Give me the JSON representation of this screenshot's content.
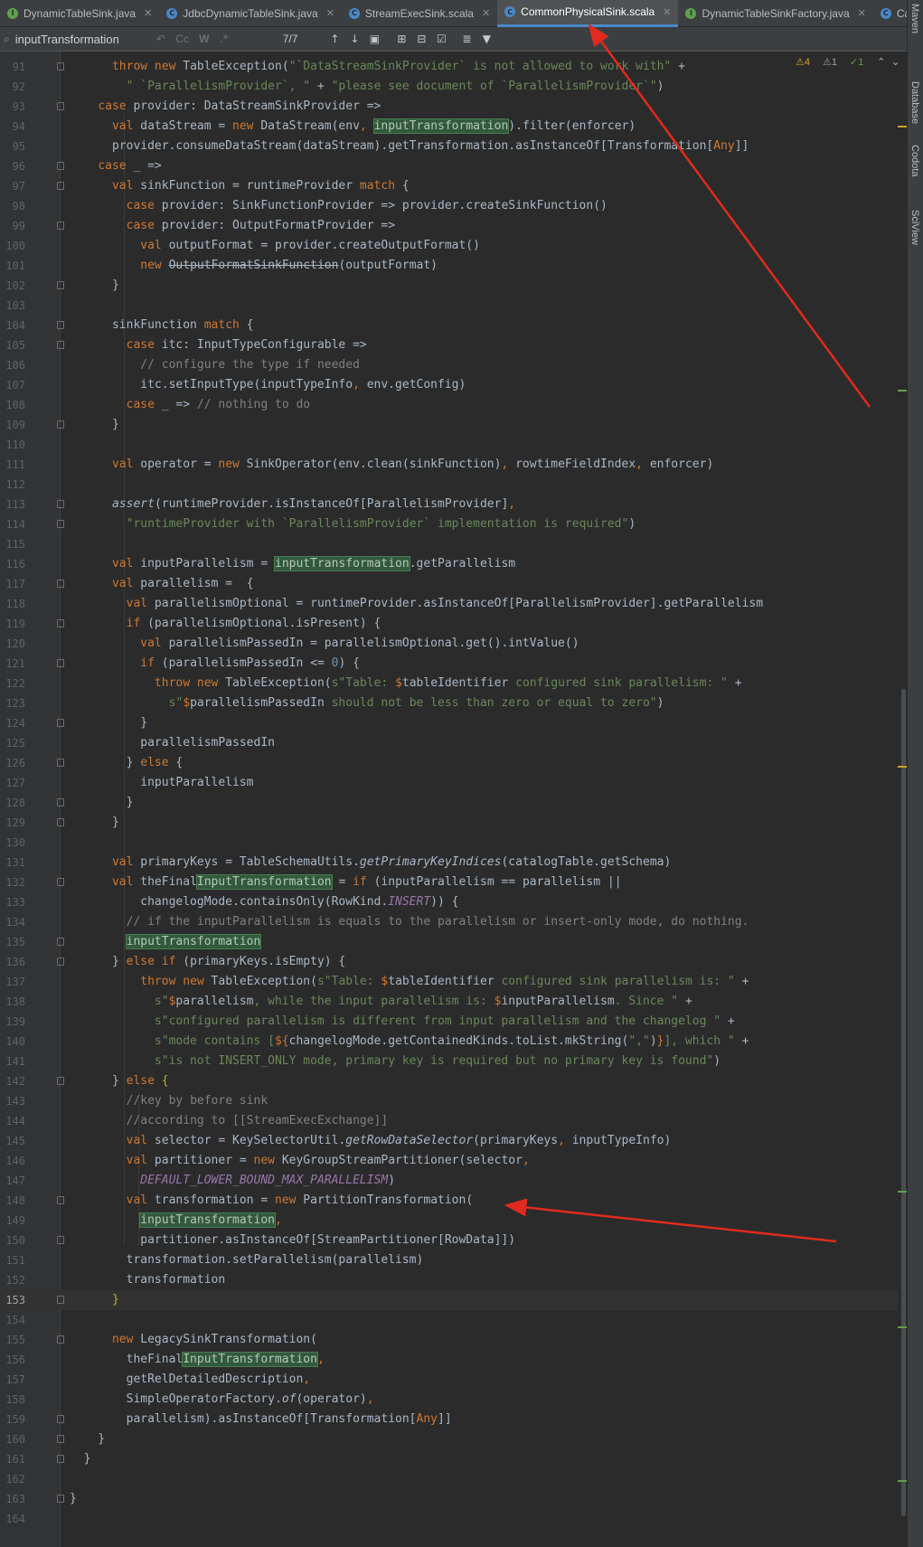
{
  "tabs": [
    {
      "label": "DynamicTableSink.java",
      "icon": "interface-icon",
      "color": "#5fa04e",
      "letter": "I",
      "active": false
    },
    {
      "label": "JdbcDynamicTableSink.java",
      "icon": "class-icon",
      "color": "#4a88c7",
      "letter": "C",
      "active": false
    },
    {
      "label": "StreamExecSink.scala",
      "icon": "scala-class-icon",
      "color": "#4a88c7",
      "letter": "C",
      "active": false
    },
    {
      "label": "CommonPhysicalSink.scala",
      "icon": "scala-class-icon",
      "color": "#4a88c7",
      "letter": "C",
      "active": true
    },
    {
      "label": "DynamicTableSinkFactory.java",
      "icon": "interface-icon",
      "color": "#5fa04e",
      "letter": "I",
      "active": false
    },
    {
      "label": "Ca",
      "icon": "class-icon",
      "color": "#4a88c7",
      "letter": "C",
      "active": false
    }
  ],
  "find": {
    "query": "inputTransformation",
    "count": "7/7",
    "opt_case": "Cc",
    "opt_word": "W",
    "opt_regex": ".*"
  },
  "inspections": {
    "warnings": "4",
    "weak": "1",
    "ok": "1"
  },
  "right_tools": [
    "Maven",
    "Database",
    "Codota",
    "SciView"
  ],
  "current_line": 153,
  "lines": [
    {
      "n": 91,
      "html": "      <span class='k'>throw new</span> TableException(<span class='s'>\"`DataStreamSinkProvider` is not allowed to work with\"</span> +"
    },
    {
      "n": 92,
      "html": "        <span class='s'>\" `ParallelismProvider`, \"</span> + <span class='s'>\"please see document of `ParallelismProvider`\"</span>)"
    },
    {
      "n": 93,
      "html": "    <span class='k'>case</span> provider: DataStreamSinkProvider =>"
    },
    {
      "n": 94,
      "html": "      <span class='k'>val</span> dataStream = <span class='k'>new</span> DataStream(env<span class='k'>,</span> <span class='hl'>inputTransformation</span>).filter(enforcer)"
    },
    {
      "n": 95,
      "html": "      provider.consumeDataStream(dataStream).getTransformation.asInstanceOf[Transformation[<span class='k'>Any</span>]]"
    },
    {
      "n": 96,
      "html": "    <span class='k'>case</span> _ =>"
    },
    {
      "n": 97,
      "html": "      <span class='k'>val</span> sinkFunction = runtimeProvider <span class='k'>match</span> {"
    },
    {
      "n": 98,
      "html": "        <span class='k'>case</span> provider: SinkFunctionProvider => provider.createSinkFunction()"
    },
    {
      "n": 99,
      "html": "        <span class='k'>case</span> provider: OutputFormatProvider =>"
    },
    {
      "n": 100,
      "html": "          <span class='k'>val</span> outputFormat = provider.createOutputFormat()"
    },
    {
      "n": 101,
      "html": "          <span class='k'>new</span> <span class='st'>OutputFormatSinkFunction</span>(outputFormat)"
    },
    {
      "n": 102,
      "html": "      }"
    },
    {
      "n": 103,
      "html": ""
    },
    {
      "n": 104,
      "html": "      sinkFunction <span class='k'>match</span> {"
    },
    {
      "n": 105,
      "html": "        <span class='k'>case</span> itc: InputTypeConfigurable =>"
    },
    {
      "n": 106,
      "html": "          <span class='c'>// configure the type if needed</span>"
    },
    {
      "n": 107,
      "html": "          itc.setInputType(inputTypeInfo<span class='k'>,</span> env.getConfig)"
    },
    {
      "n": 108,
      "html": "        <span class='k'>case</span> _ => <span class='c'>// nothing to do</span>"
    },
    {
      "n": 109,
      "html": "      }"
    },
    {
      "n": 110,
      "html": ""
    },
    {
      "n": 111,
      "html": "      <span class='k'>val</span> operator = <span class='k'>new</span> SinkOperator(env.clean(sinkFunction)<span class='k'>,</span> rowtimeFieldIndex<span class='k'>,</span> enforcer)"
    },
    {
      "n": 112,
      "html": ""
    },
    {
      "n": 113,
      "html": "      <span class='it'>assert</span>(runtimeProvider.isInstanceOf[ParallelismProvider]<span class='k'>,</span>"
    },
    {
      "n": 114,
      "html": "        <span class='s'>\"runtimeProvider with `ParallelismProvider` implementation is required\"</span>)"
    },
    {
      "n": 115,
      "html": ""
    },
    {
      "n": 116,
      "html": "      <span class='k'>val</span> inputParallelism = <span class='hl'>inputTransformation</span>.getParallelism"
    },
    {
      "n": 117,
      "html": "      <span class='k'>val</span> parallelism =  {"
    },
    {
      "n": 118,
      "html": "        <span class='k'>val</span> parallelismOptional = runtimeProvider.asInstanceOf[ParallelismProvider].getParallelism"
    },
    {
      "n": 119,
      "html": "        <span class='k'>if</span> (parallelismOptional.isPresent) {"
    },
    {
      "n": 120,
      "html": "          <span class='k'>val</span> parallelismPassedIn = parallelismOptional.get().intValue()"
    },
    {
      "n": 121,
      "html": "          <span class='k'>if</span> (parallelismPassedIn <= <span class='n'>0</span>) {"
    },
    {
      "n": 122,
      "html": "            <span class='k'>throw new</span> TableException(<span class='s'>s\"Table: </span><span class='k'>$</span>tableIdentifier<span class='s'> configured sink parallelism: \"</span> +"
    },
    {
      "n": 123,
      "html": "              <span class='s'>s\"</span><span class='k'>$</span>parallelismPassedIn<span class='s'> should not be less than zero or equal to zero\"</span>)"
    },
    {
      "n": 124,
      "html": "          }"
    },
    {
      "n": 125,
      "html": "          parallelismPassedIn"
    },
    {
      "n": 126,
      "html": "        } <span class='k'>else</span> {"
    },
    {
      "n": 127,
      "html": "          inputParallelism"
    },
    {
      "n": 128,
      "html": "        }"
    },
    {
      "n": 129,
      "html": "      }"
    },
    {
      "n": 130,
      "html": ""
    },
    {
      "n": 131,
      "html": "      <span class='k'>val</span> primaryKeys = TableSchemaUtils.<span class='it'>getPrimaryKeyIndices</span>(catalogTable.getSchema)"
    },
    {
      "n": 132,
      "html": "      <span class='k'>val</span> theFinal<span class='hl'>InputTransformation</span> = <span class='k'>if</span> (inputParallelism == parallelism ||"
    },
    {
      "n": 133,
      "html": "          changelogMode.containsOnly(RowKind.<span class='i'>INSERT</span>)) {"
    },
    {
      "n": 134,
      "html": "        <span class='c'>// if the inputParallelism is equals to the parallelism or insert-only mode, do nothing.</span>"
    },
    {
      "n": 135,
      "html": "        <span class='hl'>inputTransformation</span>"
    },
    {
      "n": 136,
      "html": "      } <span class='k'>else if</span> (primaryKeys.isEmpty) {"
    },
    {
      "n": 137,
      "html": "          <span class='k'>throw new</span> TableException(<span class='s'>s\"Table: </span><span class='k'>$</span>tableIdentifier<span class='s'> configured sink parallelism is: \"</span> +"
    },
    {
      "n": 138,
      "html": "            <span class='s'>s\"</span><span class='k'>$</span>parallelism<span class='s'>, while the input parallelism is: </span><span class='k'>$</span>inputParallelism<span class='s'>. Since \"</span> +"
    },
    {
      "n": 139,
      "html": "            <span class='s'>s\"configured parallelism is different from input parallelism and the changelog \"</span> +"
    },
    {
      "n": 140,
      "html": "            <span class='s'>s\"mode contains [</span><span class='k'>${</span>changelogMode.getContainedKinds.toList.mkString(<span class='s'>\",\"</span>)<span class='k'>}</span><span class='s'>], which \"</span> +"
    },
    {
      "n": 141,
      "html": "            <span class='s'>s\"is not INSERT_ONLY mode, primary key is required but no primary key is found\"</span>)"
    },
    {
      "n": 142,
      "html": "      } <span class='k'>else</span> <span class='y'>{</span>"
    },
    {
      "n": 143,
      "html": "        <span class='c'>//key by before sink</span>"
    },
    {
      "n": 144,
      "html": "        <span class='c'>//according to [[StreamExecExchange]]</span>"
    },
    {
      "n": 145,
      "html": "        <span class='k'>val</span> selector = KeySelectorUtil.<span class='it'>getRowDataSelector</span>(primaryKeys<span class='k'>,</span> inputTypeInfo)"
    },
    {
      "n": 146,
      "html": "        <span class='k'>val</span> partitioner = <span class='k'>new</span> KeyGroupStreamPartitioner(selector<span class='k'>,</span>"
    },
    {
      "n": 147,
      "html": "          <span class='i'>DEFAULT_LOWER_BOUND_MAX_PARALLELISM</span>)"
    },
    {
      "n": 148,
      "html": "        <span class='k'>val</span> transformation = <span class='k'>new</span> PartitionTransformation("
    },
    {
      "n": 149,
      "html": "          <span class='hl'>inputTransformation</span><span class='k'>,</span>"
    },
    {
      "n": 150,
      "html": "          partitioner.asInstanceOf[StreamPartitioner[RowData]])"
    },
    {
      "n": 151,
      "html": "        transformation.setParallelism(parallelism)"
    },
    {
      "n": 152,
      "html": "        transformation"
    },
    {
      "n": 153,
      "html": "      <span class='y'>}</span>"
    },
    {
      "n": 154,
      "html": ""
    },
    {
      "n": 155,
      "html": "      <span class='k'>new</span> LegacySinkTransformation("
    },
    {
      "n": 156,
      "html": "        theFinal<span class='hl'>InputTransformation</span><span class='k'>,</span>"
    },
    {
      "n": 157,
      "html": "        getRelDetailedDescription<span class='k'>,</span>"
    },
    {
      "n": 158,
      "html": "        SimpleOperatorFactory.<span class='it'>of</span>(operator)<span class='k'>,</span>"
    },
    {
      "n": 159,
      "html": "        parallelism).asInstanceOf[Transformation[<span class='k'>Any</span>]]"
    },
    {
      "n": 160,
      "html": "    }"
    },
    {
      "n": 161,
      "html": "  }"
    },
    {
      "n": 162,
      "html": ""
    },
    {
      "n": 163,
      "html": "}"
    },
    {
      "n": 164,
      "html": ""
    }
  ]
}
